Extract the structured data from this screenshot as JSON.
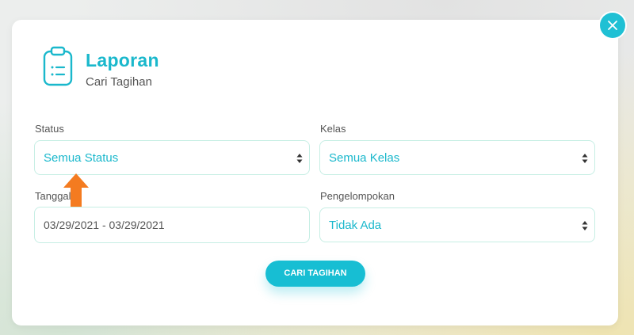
{
  "header": {
    "title": "Laporan",
    "subtitle": "Cari Tagihan",
    "icon": "clipboard-icon"
  },
  "form": {
    "status": {
      "label": "Status",
      "value": "Semua Status"
    },
    "kelas": {
      "label": "Kelas",
      "value": "Semua Kelas"
    },
    "tanggal": {
      "label": "Tanggal",
      "value": "03/29/2021 - 03/29/2021"
    },
    "pengelompokan": {
      "label": "Pengelompokan",
      "value": "Tidak Ada"
    }
  },
  "actions": {
    "search_label": "CARI TAGIHAN",
    "close_icon": "close-icon"
  },
  "colors": {
    "accent": "#1ab8cc",
    "field_border": "#c6eee4",
    "annotation_arrow": "#f47b20"
  }
}
